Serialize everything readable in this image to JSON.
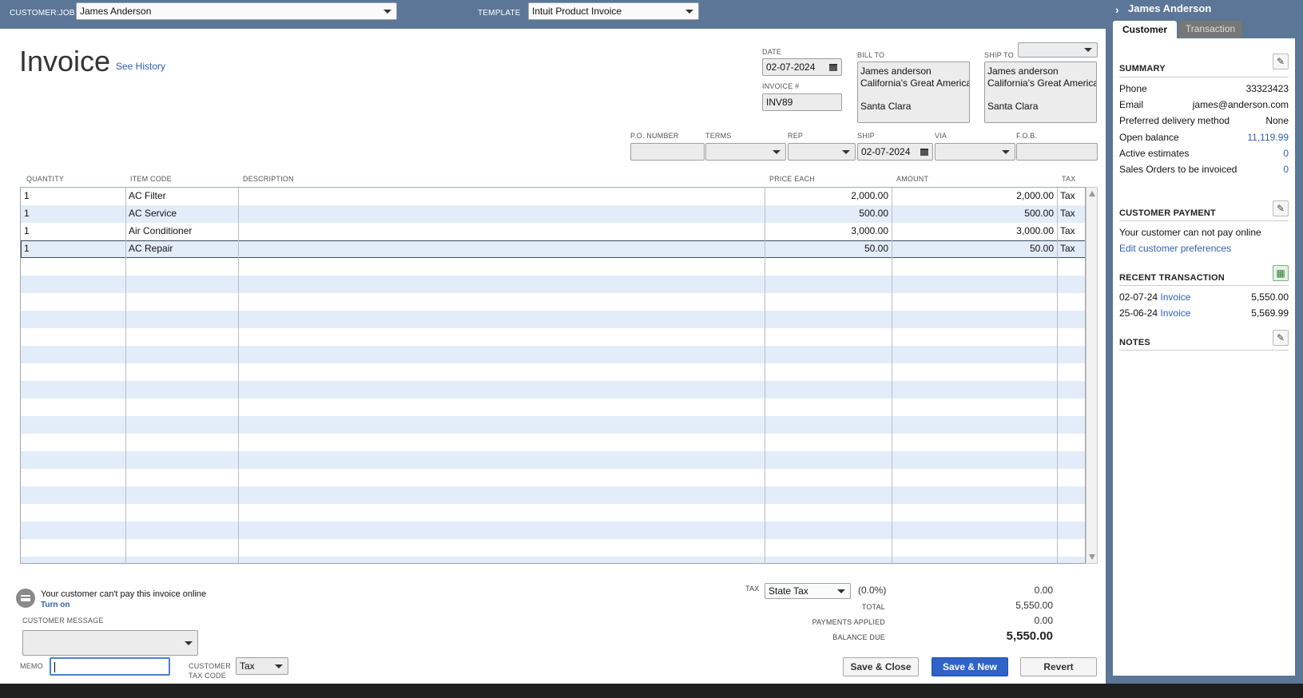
{
  "topbar": {
    "customer_job_label": "CUSTOMER:JOB",
    "customer_job_value": "James Anderson",
    "template_label": "TEMPLATE",
    "template_value": "Intuit Product Invoice"
  },
  "header": {
    "title": "Invoice",
    "see_history": "See History",
    "date_label": "DATE",
    "date_value": "02-07-2024",
    "invoice_no_label": "INVOICE #",
    "invoice_no_value": "INV89",
    "bill_to_label": "BILL TO",
    "bill_to_lines": [
      "James anderson",
      "California's Great America",
      "",
      "Santa Clara"
    ],
    "ship_to_label": "SHIP TO",
    "ship_to_lines": [
      "James anderson",
      "California's Great America",
      "",
      "Santa Clara"
    ]
  },
  "order_fields": {
    "po_label": "P.O. NUMBER",
    "po_value": "",
    "terms_label": "TERMS",
    "terms_value": "",
    "rep_label": "REP",
    "rep_value": "",
    "ship_label": "SHIP",
    "ship_value": "02-07-2024",
    "via_label": "VIA",
    "via_value": "",
    "fob_label": "F.O.B.",
    "fob_value": ""
  },
  "items_table": {
    "columns": [
      "QUANTITY",
      "ITEM CODE",
      "DESCRIPTION",
      "PRICE EACH",
      "AMOUNT",
      "TAX"
    ],
    "rows": [
      {
        "quantity": "1",
        "item": "AC Filter",
        "description": "",
        "price": "2,000.00",
        "amount": "2,000.00",
        "tax": "Tax"
      },
      {
        "quantity": "1",
        "item": "AC Service",
        "description": "",
        "price": "500.00",
        "amount": "500.00",
        "tax": "Tax"
      },
      {
        "quantity": "1",
        "item": "Air Conditioner",
        "description": "",
        "price": "3,000.00",
        "amount": "3,000.00",
        "tax": "Tax"
      },
      {
        "quantity": "1",
        "item": "AC Repair",
        "description": "",
        "price": "50.00",
        "amount": "50.00",
        "tax": "Tax"
      }
    ]
  },
  "footer": {
    "online_notice": "Your customer can't pay this invoice online",
    "turn_on": "Turn on",
    "customer_message_label": "CUSTOMER MESSAGE",
    "customer_message_value": "",
    "memo_label": "MEMO",
    "memo_value": "",
    "customer_tax_code_label_1": "CUSTOMER",
    "customer_tax_code_label_2": "TAX CODE",
    "customer_tax_code_value": "Tax",
    "tax_label": "TAX",
    "tax_value": "State Tax",
    "tax_rate": "(0.0%)",
    "tax_amount": "0.00",
    "total_label": "TOTAL",
    "total_value": "5,550.00",
    "payments_label": "PAYMENTS APPLIED",
    "payments_value": "0.00",
    "balance_label": "BALANCE DUE",
    "balance_value": "5,550.00",
    "save_close": "Save & Close",
    "save_new": "Save & New",
    "revert": "Revert"
  },
  "sidebar": {
    "customer_name": "James Anderson",
    "tab_customer": "Customer",
    "tab_transaction": "Transaction",
    "summary_title": "SUMMARY",
    "summary": [
      {
        "label": "Phone",
        "value": "33323423",
        "link": false
      },
      {
        "label": "Email",
        "value": "james@anderson.com",
        "link": false
      },
      {
        "label": "Preferred delivery method",
        "value": "None",
        "link": false
      },
      {
        "label": "Open balance",
        "value": "11,119.99",
        "link": true
      },
      {
        "label": "Active estimates",
        "value": "0",
        "link": true
      },
      {
        "label": "Sales Orders to be invoiced",
        "value": "0",
        "link": true
      }
    ],
    "payment_title": "CUSTOMER PAYMENT",
    "payment_text": "Your customer can not pay online",
    "payment_link": "Edit customer preferences",
    "recent_title": "RECENT TRANSACTION",
    "recent": [
      {
        "date": "02-07-24",
        "type": "Invoice",
        "amount": "5,550.00"
      },
      {
        "date": "25-06-24",
        "type": "Invoice",
        "amount": "5,569.99"
      }
    ],
    "notes_title": "NOTES"
  },
  "colors": {
    "header_bar": "#5b7696",
    "row_stripe": "#e3edfa",
    "link": "#2f5fb3",
    "primary_button": "#2f63c8"
  }
}
